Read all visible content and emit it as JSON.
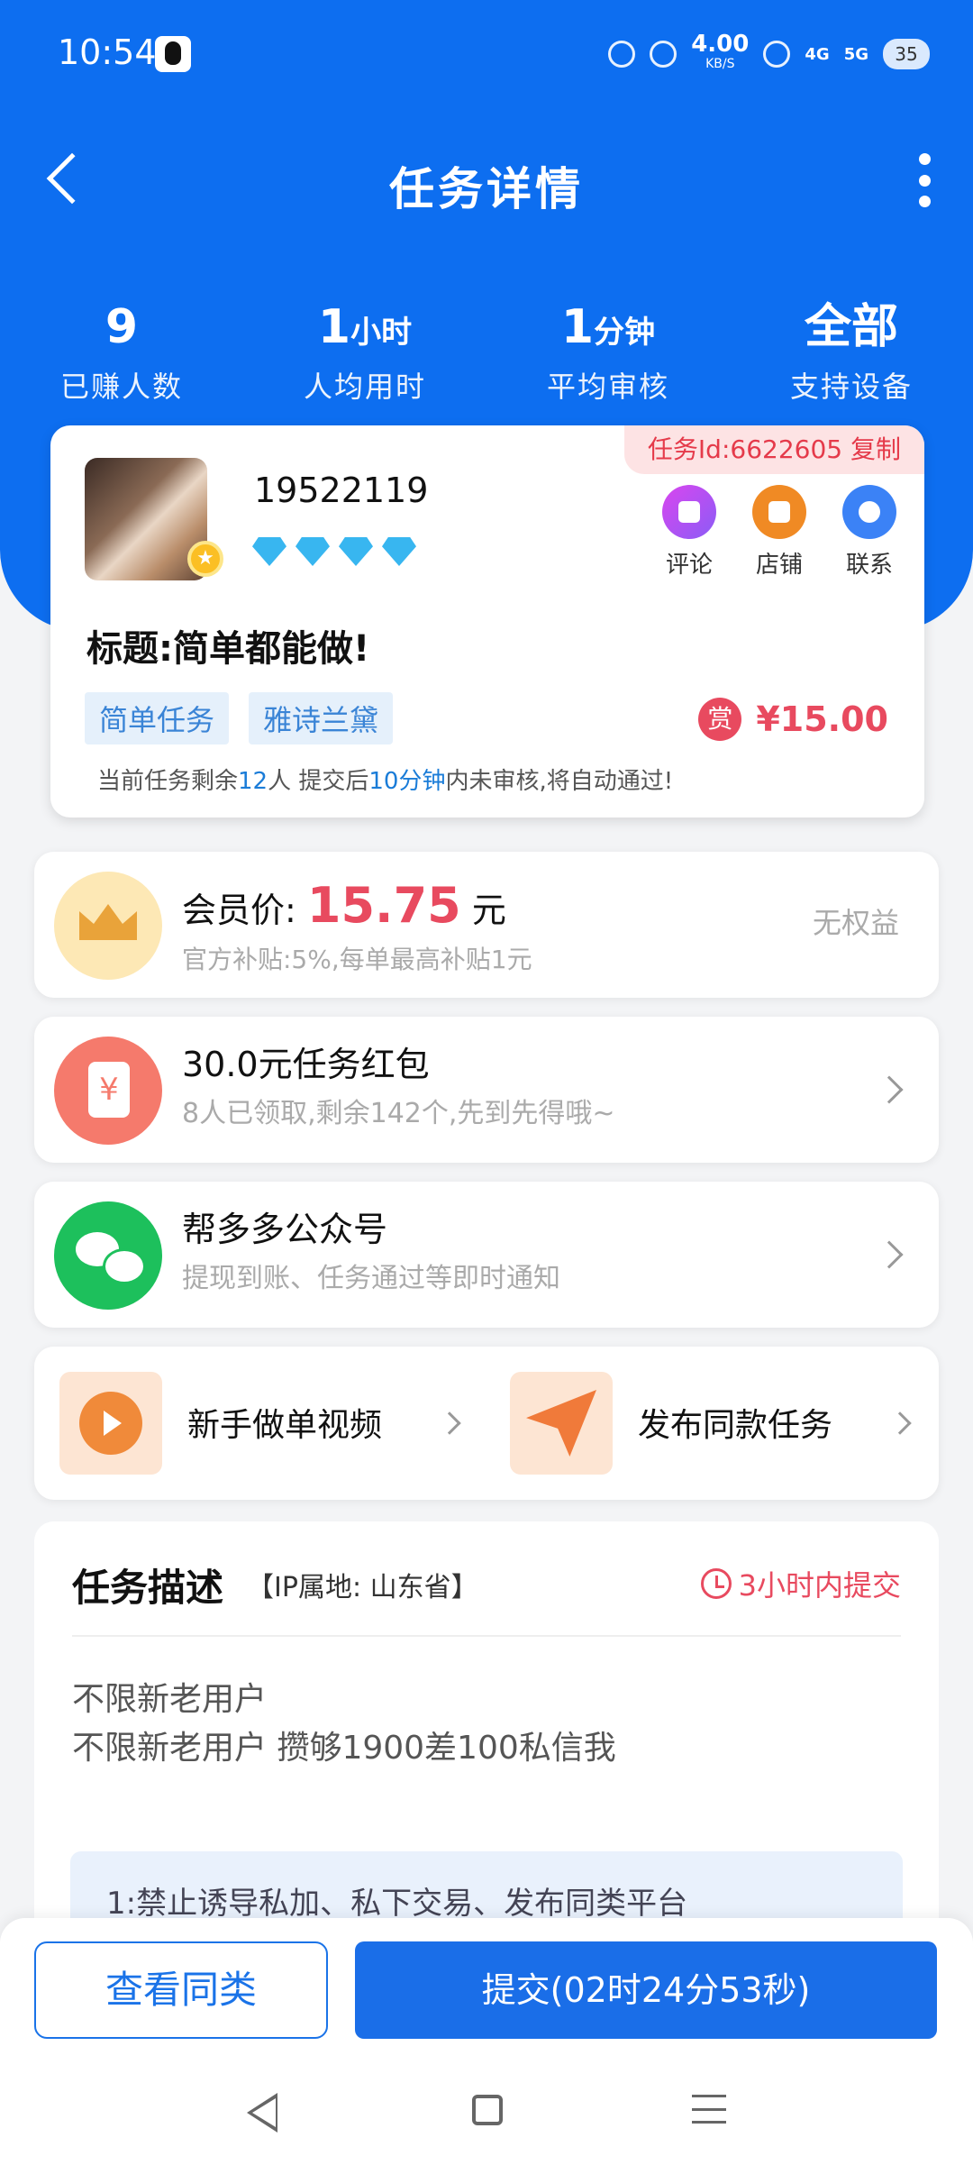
{
  "status_bar": {
    "time": "10:54",
    "speed_value": "4.00",
    "speed_unit": "KB/S",
    "net1": "4G",
    "net2": "5G",
    "battery": "35"
  },
  "header": {
    "title": "任务详情"
  },
  "stats": [
    {
      "value": "9",
      "unit": "",
      "label": "已赚人数"
    },
    {
      "value": "1",
      "unit": "小时",
      "label": "人均用时"
    },
    {
      "value": "1",
      "unit": "分钟",
      "label": "平均审核"
    },
    {
      "value": "全部",
      "unit": "",
      "label": "支持设备"
    }
  ],
  "task_card": {
    "task_id": "任务Id:6622605 复制",
    "user_name": "19522119",
    "diamond_count": 4,
    "actions": [
      {
        "label": "评论",
        "icon": "comment-icon"
      },
      {
        "label": "店铺",
        "icon": "shop-icon"
      },
      {
        "label": "联系",
        "icon": "chat-icon"
      }
    ],
    "title": "标题:简单都能做!",
    "tags": [
      "简单任务",
      "雅诗兰黛"
    ],
    "reward_badge": "赏",
    "reward_amount": "¥15.00",
    "note_prefix": "当前任务剩余",
    "note_remaining": "12",
    "note_mid": "人  提交后",
    "note_review_time": "10分钟",
    "note_suffix": "内未审核,将自动通过!"
  },
  "member": {
    "label": "会员价:",
    "price": "15.75",
    "unit": "元",
    "subtitle": "官方补贴:5%,每单最高补贴1元",
    "status": "无权益"
  },
  "redpack": {
    "title": "30.0元任务红包",
    "subtitle": "8人已领取,剩余142个,先到先得哦~"
  },
  "official_account": {
    "title": "帮多多公众号",
    "subtitle": "提现到账、任务通过等即时通知"
  },
  "quick_links": [
    {
      "label": "新手做单视频",
      "icon": "play-video-icon"
    },
    {
      "label": "发布同款任务",
      "icon": "send-icon"
    }
  ],
  "description": {
    "title": "任务描述",
    "ip_location": "【IP属地: 山东省】",
    "deadline": "3小时内提交",
    "lines": [
      "不限新老用户",
      "不限新老用户 攒够1900差100私信我"
    ],
    "rule_text": "1:禁止诱导私加、私下交易、发布同类平台"
  },
  "bottom_bar": {
    "similar_label": "查看同类",
    "submit_label": "提交(02时24分53秒)"
  },
  "colors": {
    "primary_blue": "#0d6ef0",
    "reward_red": "#e84a5f",
    "tag_blue": "#3a84d6"
  }
}
